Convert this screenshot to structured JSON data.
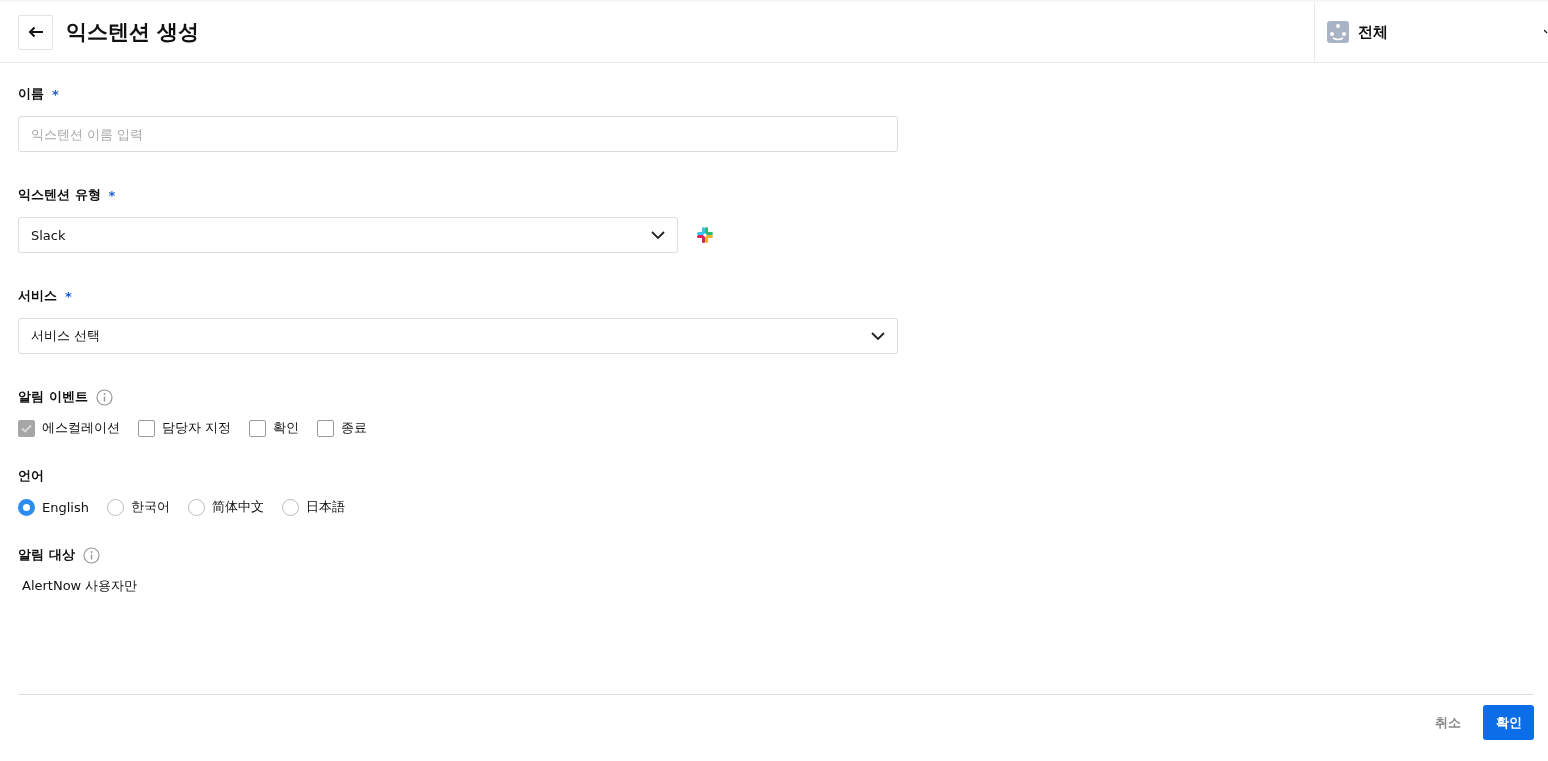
{
  "header": {
    "title": "익스텐션 생성",
    "workspace": "전체"
  },
  "name_field": {
    "label": "이름",
    "required_mark": "*",
    "placeholder": "익스텐션 이름 입력"
  },
  "type_field": {
    "label": "익스텐션 유형",
    "required_mark": "*",
    "value": "Slack"
  },
  "service_field": {
    "label": "서비스",
    "required_mark": "*",
    "value": "서비스 선택"
  },
  "events": {
    "label": "알림 이벤트",
    "options": [
      {
        "label": "에스컬레이션",
        "checked": true,
        "disabled": true
      },
      {
        "label": "담당자 지정",
        "checked": false,
        "disabled": false
      },
      {
        "label": "확인",
        "checked": false,
        "disabled": false
      },
      {
        "label": "종료",
        "checked": false,
        "disabled": false
      }
    ]
  },
  "language": {
    "label": "언어",
    "options": [
      {
        "label": "English",
        "selected": true
      },
      {
        "label": "한국어",
        "selected": false
      },
      {
        "label": "简体中文",
        "selected": false
      },
      {
        "label": "日本語",
        "selected": false
      }
    ]
  },
  "target": {
    "label": "알림 대상",
    "value": "AlertNow 사용자만"
  },
  "buttons": {
    "cancel": "취소",
    "confirm": "확인"
  }
}
